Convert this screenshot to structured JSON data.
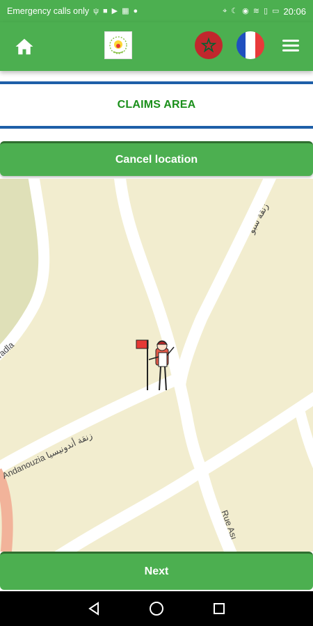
{
  "status_bar": {
    "carrier_text": "Emergency calls only",
    "time": "20:06",
    "icons": [
      "usb-icon",
      "box-icon",
      "youtube-icon",
      "calendar-icon",
      "circle-icon",
      "location-icon",
      "moon-icon",
      "eye-icon",
      "wifi-icon",
      "sim-icon",
      "battery-icon"
    ]
  },
  "header": {
    "home_icon": "home-icon",
    "logo_icon": "app-logo",
    "flags": [
      "morocco-flag",
      "france-flag"
    ],
    "menu_icon": "hamburger-menu-icon"
  },
  "claims": {
    "title": "CLAIMS AREA"
  },
  "actions": {
    "cancel_label": "Cancel location",
    "next_label": "Next"
  },
  "map": {
    "streets": [
      {
        "label": "Tadla"
      },
      {
        "label": "زنقة سبو"
      },
      {
        "label": "Andanouzia  زنقة أندونيسيا"
      },
      {
        "label": "Rue Ası"
      }
    ],
    "marker_icon": "hiker-with-flag-icon"
  },
  "nav_bar": {
    "buttons": [
      "back-icon",
      "home-circle-icon",
      "recents-icon"
    ]
  },
  "colors": {
    "primary": "#4caf50",
    "accent_blue": "#1e5fa8",
    "title_green": "#1a8f1a",
    "map_bg": "#f2edcf"
  }
}
